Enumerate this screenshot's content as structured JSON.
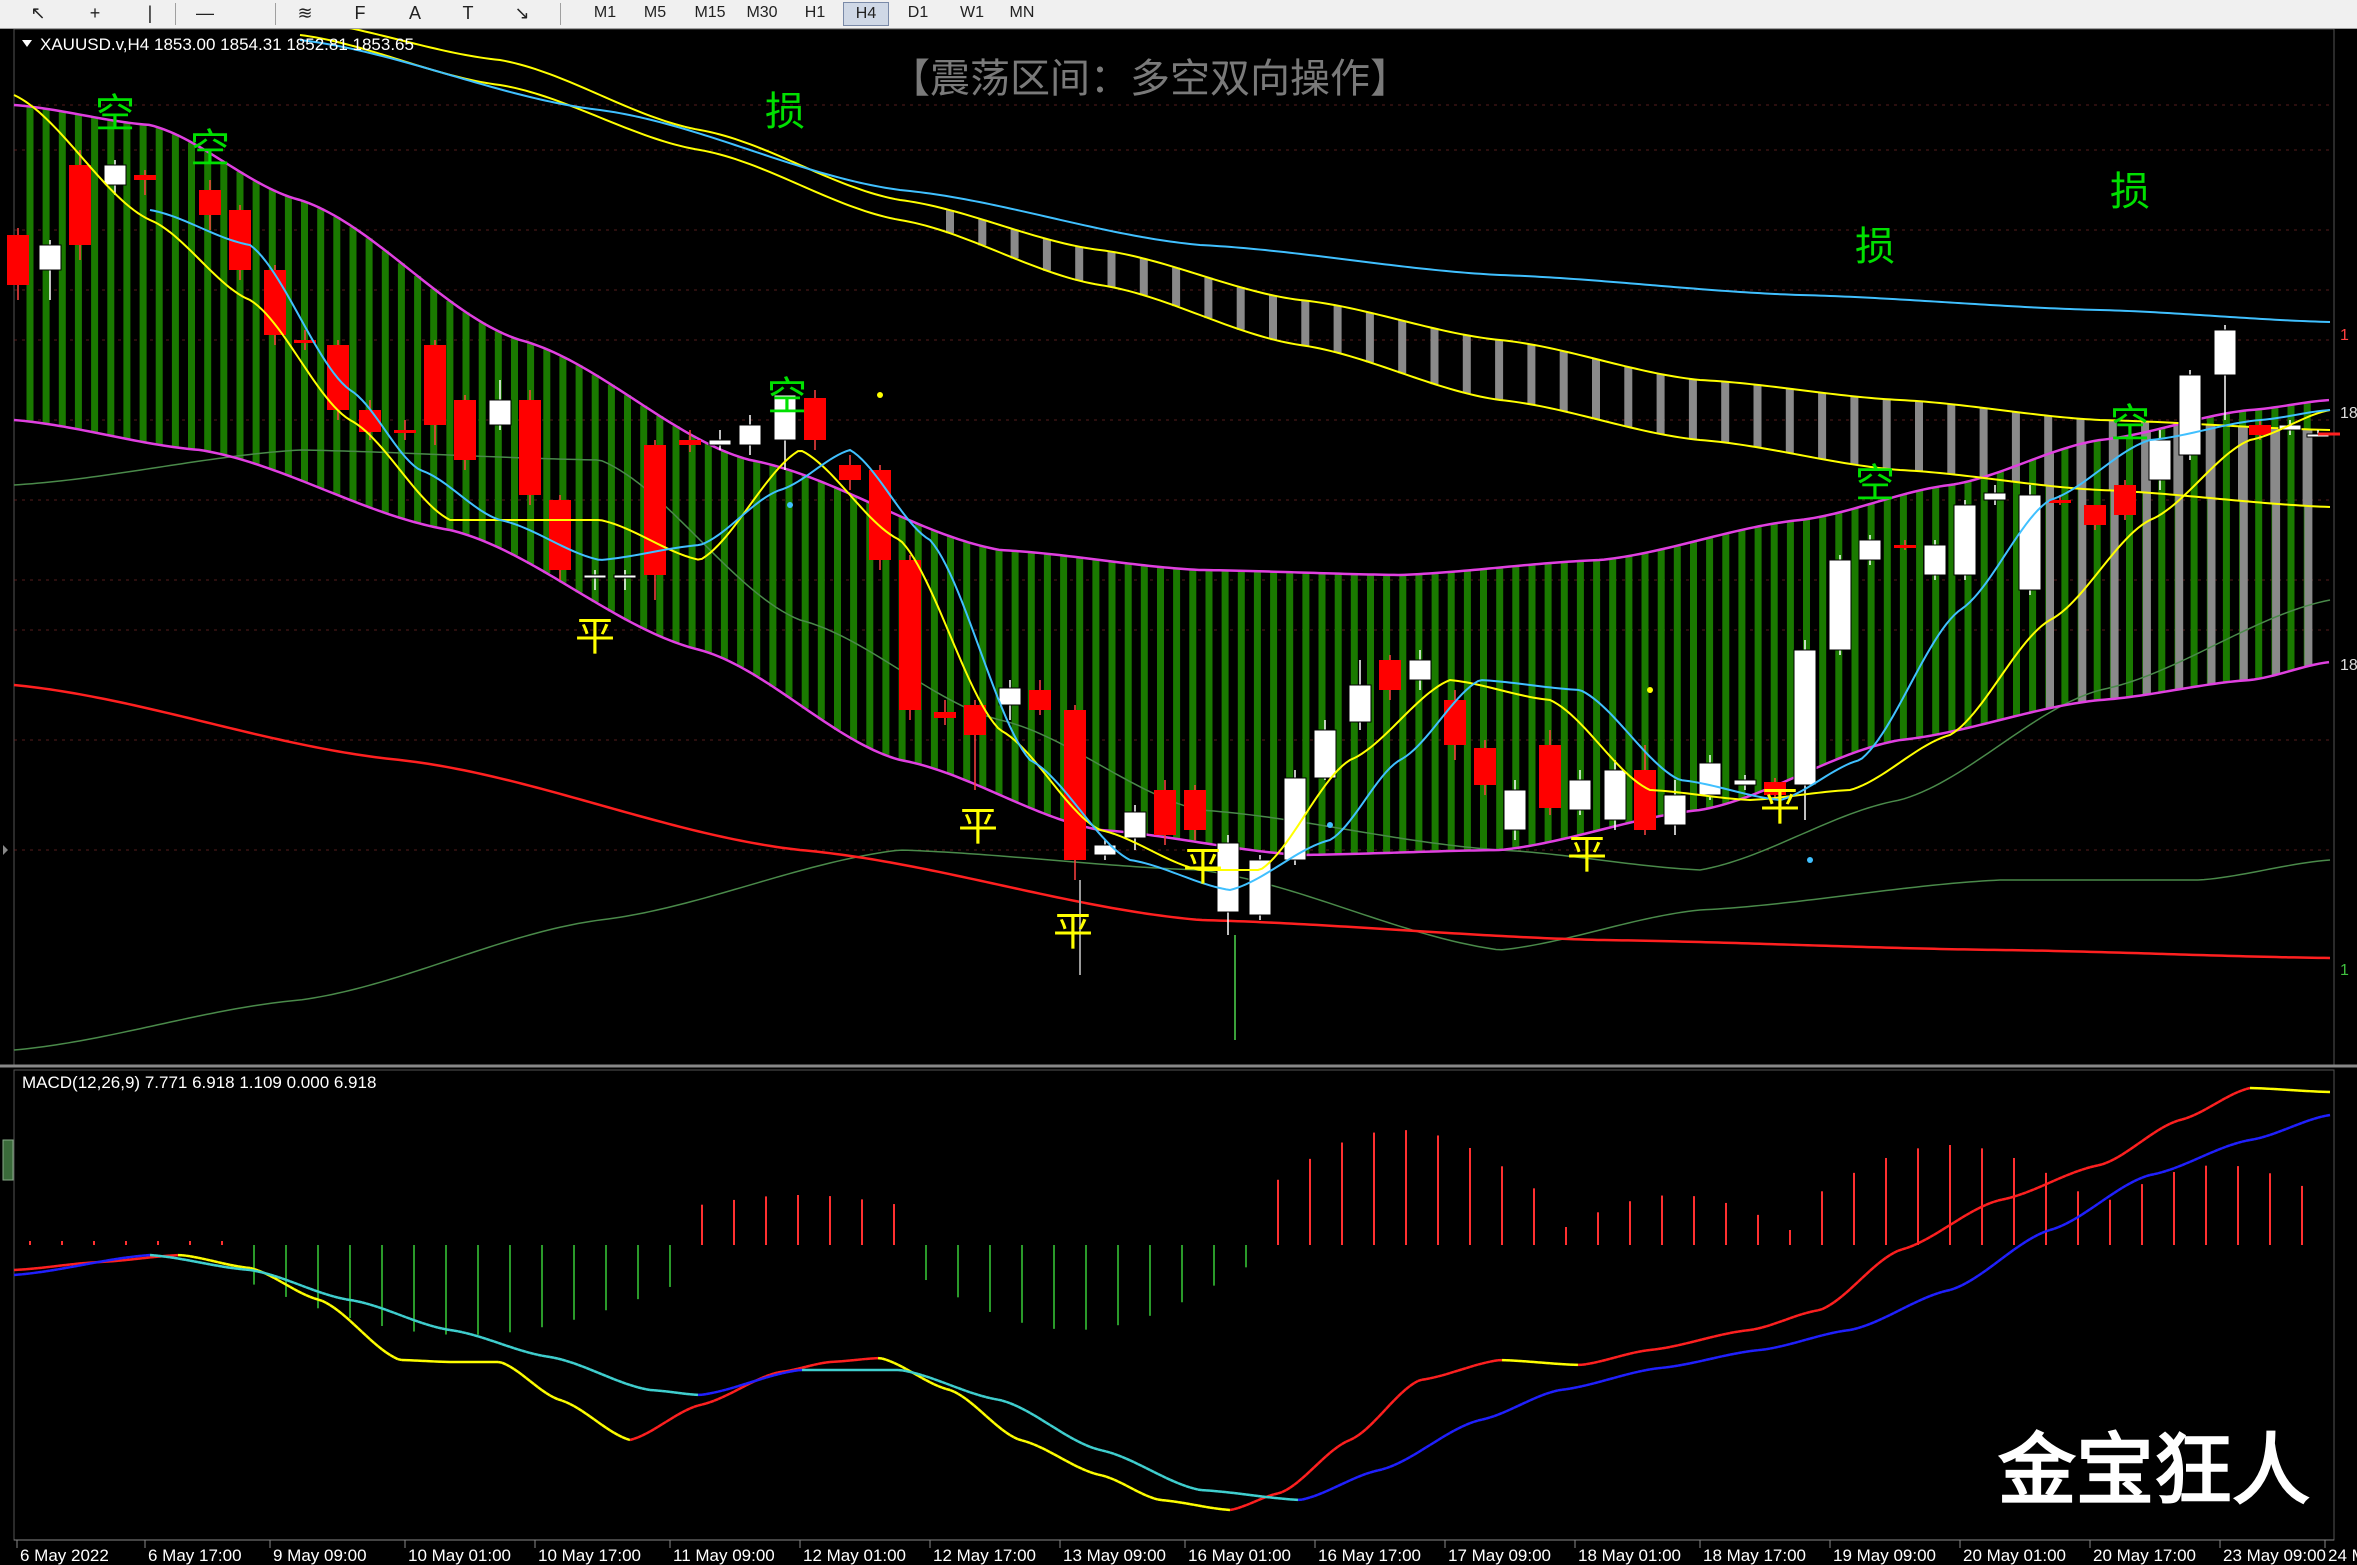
{
  "toolbar": {
    "tools": [
      {
        "name": "cursor-icon",
        "glyph": "↖"
      },
      {
        "name": "crosshair-icon",
        "glyph": "+"
      },
      {
        "name": "vertical-line-icon",
        "glyph": "|"
      },
      {
        "name": "horizontal-line-icon",
        "glyph": "—"
      },
      {
        "name": "fibo-icon",
        "glyph": "≋"
      },
      {
        "name": "fibo-fan-icon",
        "glyph": "F"
      },
      {
        "name": "text-icon",
        "glyph": "A"
      },
      {
        "name": "text-label-icon",
        "glyph": "T"
      },
      {
        "name": "arrows-icon",
        "glyph": "↘"
      }
    ],
    "timeframes": [
      "M1",
      "M5",
      "M15",
      "M30",
      "H1",
      "H4",
      "D1",
      "W1",
      "MN"
    ],
    "active_timeframe": "H4"
  },
  "main": {
    "symbol_line": "XAUUSD.v,H4  1853.00 1854.31 1852.81 1853.65",
    "banner": "【震荡区间：多空双向操作】",
    "markers": [
      {
        "text": "空",
        "color": "#00e000"
      },
      {
        "text": "空",
        "color": "#00e000"
      },
      {
        "text": "损",
        "color": "#00e000"
      },
      {
        "text": "空",
        "color": "#00e000"
      },
      {
        "text": "损",
        "color": "#00e000"
      },
      {
        "text": "损",
        "color": "#00e000"
      },
      {
        "text": "空",
        "color": "#00e000"
      },
      {
        "text": "空",
        "color": "#00e000"
      },
      {
        "text": "平",
        "color": "#ffff00"
      },
      {
        "text": "平",
        "color": "#ffff00"
      },
      {
        "text": "平",
        "color": "#ffff00"
      },
      {
        "text": "平",
        "color": "#ffff00"
      },
      {
        "text": "平",
        "color": "#ffff00"
      },
      {
        "text": "平",
        "color": "#ffff00"
      }
    ],
    "right_scale_labels": [
      "1",
      "18",
      "18",
      "1"
    ],
    "watermark": "金宝狂人"
  },
  "macd": {
    "label": "MACD(12,26,9) 7.771 6.918 1.109 0.000 6.918"
  },
  "time_axis": [
    "6 May 2022",
    "6 May 17:00",
    "9 May 09:00",
    "10 May 01:00",
    "10 May 17:00",
    "11 May 09:00",
    "12 May 01:00",
    "12 May 17:00",
    "13 May 09:00",
    "16 May 01:00",
    "16 May 17:00",
    "17 May 09:00",
    "18 May 01:00",
    "18 May 17:00",
    "19 May 09:00",
    "20 May 01:00",
    "20 May 17:00",
    "23 May 09:00",
    "24 M"
  ],
  "colors": {
    "bull": "#ffffff",
    "bear": "#ff0000",
    "band_fill_green": "#1a7a00",
    "band_fill_grey": "#8a8a8a",
    "magenta": "#e040e0",
    "yellow": "#ffff00",
    "cyan": "#40c0ff",
    "red_ma": "#ff2020"
  },
  "chart_data": {
    "type": "candlestick",
    "symbol": "XAUUSD.v",
    "timeframe": "H4",
    "ohlc_last": {
      "open": 1853.0,
      "high": 1854.31,
      "low": 1852.81,
      "close": 1853.65
    },
    "candles_relative_ohlc": []
  }
}
